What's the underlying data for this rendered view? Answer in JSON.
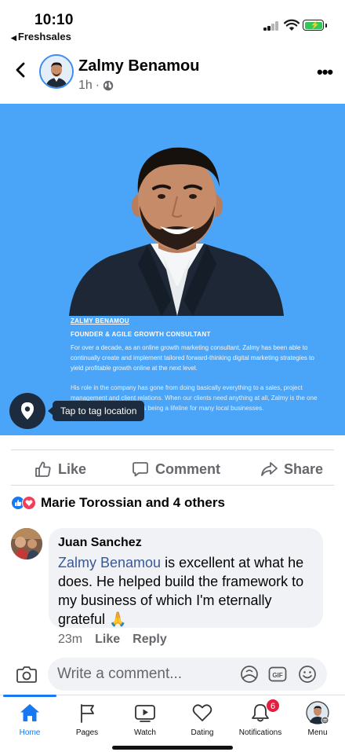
{
  "status_bar": {
    "time": "10:10",
    "back_app": "Freshsales"
  },
  "post": {
    "author": "Zalmy Benamou",
    "time_ago": "1h",
    "meta_separator": "·",
    "image": {
      "bio_name": "ZALMY BENAMOU",
      "bio_title": "FOUNDER & AGILE GROWTH CONSULTANT",
      "bio_paragraph_1": "For over a decade, as an online growth marketing consultant, Zalmy has been able to continually create and implement tailored forward-thinking digital marketing strategies to yield profitable growth online at the next level.",
      "bio_paragraph_2": "His role in the company has gone from doing basically everything to a sales, project management and client relations. When our clients need anything at all, Zalmy is the one they call, and he truly loves being a lifeline for many local businesses.",
      "tag_tooltip": "Tap to tag location",
      "background_color": "#4aa4f7"
    },
    "actions": {
      "like": "Like",
      "comment": "Comment",
      "share": "Share"
    },
    "reactions_text": "Marie Torossian and 4 others"
  },
  "comment": {
    "author": "Juan Sanchez",
    "mention": "Zalmy Benamou",
    "text": " is excellent at what he does. He helped build the framework to my business of which I'm eternally grateful 🙏",
    "time_ago": "23m",
    "like": "Like",
    "reply": "Reply"
  },
  "composer": {
    "placeholder": "Write a comment..."
  },
  "tabs": [
    {
      "label": "Home",
      "icon": "home-icon",
      "active": true
    },
    {
      "label": "Pages",
      "icon": "flag-icon",
      "active": false
    },
    {
      "label": "Watch",
      "icon": "watch-icon",
      "active": false
    },
    {
      "label": "Dating",
      "icon": "heart-icon",
      "active": false
    },
    {
      "label": "Notifications",
      "icon": "bell-icon",
      "active": false,
      "badge": "6"
    },
    {
      "label": "Menu",
      "icon": "profile-avatar-icon",
      "active": false
    }
  ],
  "colors": {
    "accent": "#1877f2",
    "mention": "#385898",
    "badge": "#e41e3f"
  }
}
